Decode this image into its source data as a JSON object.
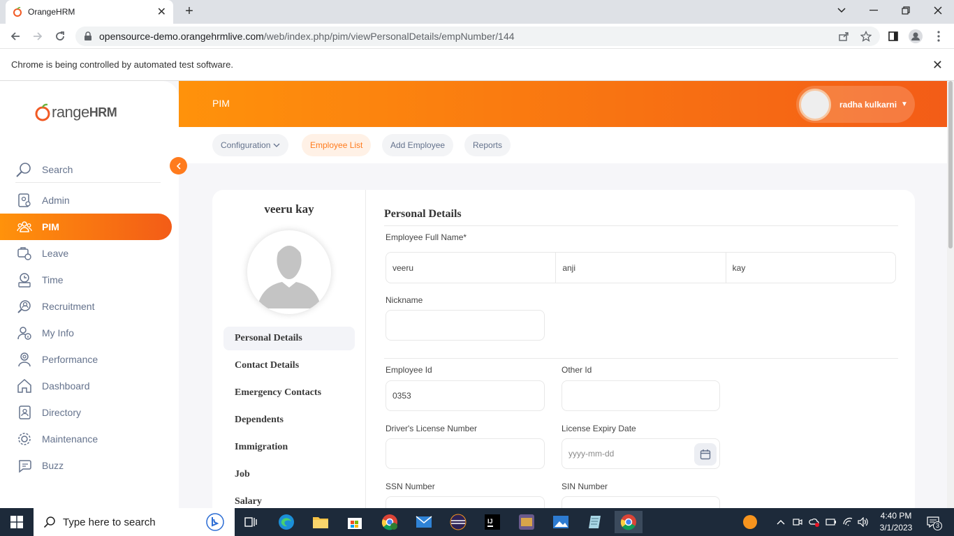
{
  "browser": {
    "tab_title": "OrangeHRM",
    "url_host": "opensource-demo.orangehrmlive.com",
    "url_path": "/web/index.php/pim/viewPersonalDetails/empNumber/144",
    "infobar_text": "Chrome is being controlled by automated test software."
  },
  "brand": {
    "logo_prefix": "range",
    "logo_suffix": "HRM",
    "accent": "#ff7b1d"
  },
  "sidebar": {
    "search_label": "Search",
    "items": [
      {
        "label": "Admin",
        "icon": "admin-icon"
      },
      {
        "label": "PIM",
        "icon": "pim-icon",
        "active": true
      },
      {
        "label": "Leave",
        "icon": "leave-icon"
      },
      {
        "label": "Time",
        "icon": "time-icon"
      },
      {
        "label": "Recruitment",
        "icon": "recruitment-icon"
      },
      {
        "label": "My Info",
        "icon": "myinfo-icon"
      },
      {
        "label": "Performance",
        "icon": "performance-icon"
      },
      {
        "label": "Dashboard",
        "icon": "dashboard-icon"
      },
      {
        "label": "Directory",
        "icon": "directory-icon"
      },
      {
        "label": "Maintenance",
        "icon": "maintenance-icon"
      },
      {
        "label": "Buzz",
        "icon": "buzz-icon"
      }
    ]
  },
  "header": {
    "module": "PIM",
    "user_name": "radha kulkarni"
  },
  "subnav": {
    "configuration": "Configuration",
    "employee_list": "Employee List",
    "add_employee": "Add Employee",
    "reports": "Reports"
  },
  "profile": {
    "name": "veeru kay",
    "tabs": [
      "Personal Details",
      "Contact Details",
      "Emergency Contacts",
      "Dependents",
      "Immigration",
      "Job",
      "Salary"
    ]
  },
  "form": {
    "title": "Personal Details",
    "full_name_label": "Employee Full Name*",
    "first_name": "veeru",
    "middle_name": "anji",
    "last_name": "kay",
    "nickname_label": "Nickname",
    "nickname": "",
    "employee_id_label": "Employee Id",
    "employee_id": "0353",
    "other_id_label": "Other Id",
    "other_id": "",
    "license_label": "Driver's License Number",
    "license": "",
    "license_expiry_label": "License Expiry Date",
    "license_expiry_placeholder": "yyyy-mm-dd",
    "ssn_label": "SSN Number",
    "sin_label": "SIN Number"
  },
  "taskbar": {
    "search_placeholder": "Type here to search",
    "time": "4:40 PM",
    "date": "3/1/2023",
    "notification_count": "3"
  }
}
